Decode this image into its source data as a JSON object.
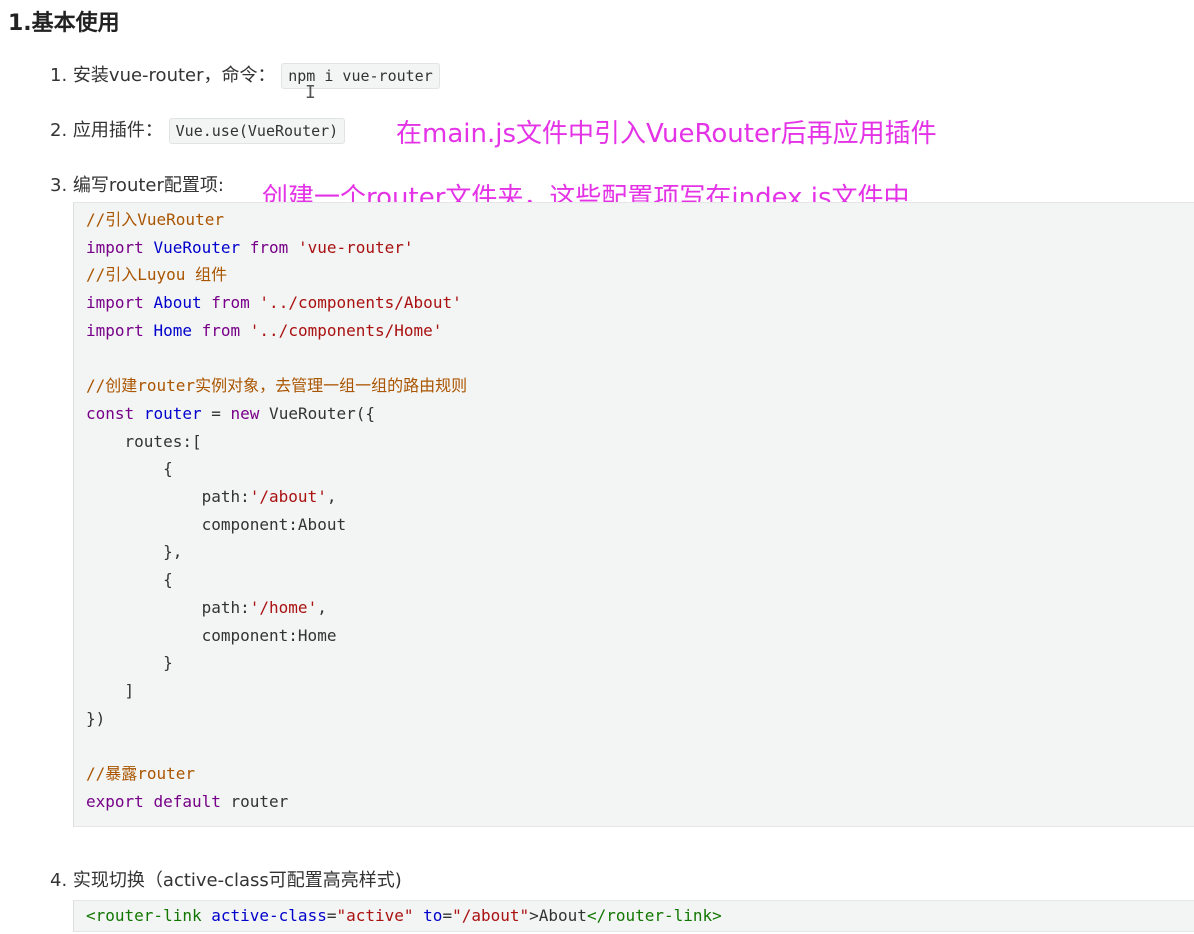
{
  "heading": "1.基本使用",
  "items": [
    {
      "number": "1.",
      "text": "安装vue-router，命令：",
      "code": "npm i vue-router"
    },
    {
      "number": "2.",
      "text": "应用插件：",
      "code": "Vue.use(VueRouter)"
    },
    {
      "number": "3.",
      "text": "编写router配置项:"
    },
    {
      "number": "4.",
      "text": "实现切换（active-class可配置高亮样式)"
    }
  ],
  "annotations": {
    "plugin_note": "在main.js文件中引入VueRouter后再应用插件",
    "config_note": "创建一个router文件夹，这些配置项写在index.js文件中"
  },
  "code_block": {
    "lines": [
      [
        {
          "t": "//引入VueRouter",
          "c": "comment"
        }
      ],
      [
        {
          "t": "import",
          "c": "kw"
        },
        {
          "t": " ",
          "c": "def"
        },
        {
          "t": "VueRouter",
          "c": "var"
        },
        {
          "t": " ",
          "c": "def"
        },
        {
          "t": "from",
          "c": "kw"
        },
        {
          "t": " ",
          "c": "def"
        },
        {
          "t": "'vue-router'",
          "c": "str"
        }
      ],
      [
        {
          "t": "//引入Luyou 组件",
          "c": "comment"
        }
      ],
      [
        {
          "t": "import",
          "c": "kw"
        },
        {
          "t": " ",
          "c": "def"
        },
        {
          "t": "About",
          "c": "var"
        },
        {
          "t": " ",
          "c": "def"
        },
        {
          "t": "from",
          "c": "kw"
        },
        {
          "t": " ",
          "c": "def"
        },
        {
          "t": "'../components/About'",
          "c": "str"
        }
      ],
      [
        {
          "t": "import",
          "c": "kw"
        },
        {
          "t": " ",
          "c": "def"
        },
        {
          "t": "Home",
          "c": "var"
        },
        {
          "t": " ",
          "c": "def"
        },
        {
          "t": "from",
          "c": "kw"
        },
        {
          "t": " ",
          "c": "def"
        },
        {
          "t": "'../components/Home'",
          "c": "str"
        }
      ],
      [],
      [
        {
          "t": "//创建router实例对象，去管理一组一组的路由规则",
          "c": "comment"
        }
      ],
      [
        {
          "t": "const",
          "c": "kw"
        },
        {
          "t": " ",
          "c": "def"
        },
        {
          "t": "router",
          "c": "var"
        },
        {
          "t": " = ",
          "c": "def"
        },
        {
          "t": "new",
          "c": "kw"
        },
        {
          "t": " VueRouter({",
          "c": "def"
        }
      ],
      [
        {
          "t": "    routes:[",
          "c": "def"
        }
      ],
      [
        {
          "t": "        {",
          "c": "def"
        }
      ],
      [
        {
          "t": "            path:",
          "c": "def"
        },
        {
          "t": "'/about'",
          "c": "str"
        },
        {
          "t": ",",
          "c": "def"
        }
      ],
      [
        {
          "t": "            component:About",
          "c": "def"
        }
      ],
      [
        {
          "t": "        },",
          "c": "def"
        }
      ],
      [
        {
          "t": "        {",
          "c": "def"
        }
      ],
      [
        {
          "t": "            path:",
          "c": "def"
        },
        {
          "t": "'/home'",
          "c": "str"
        },
        {
          "t": ",",
          "c": "def"
        }
      ],
      [
        {
          "t": "            component:Home",
          "c": "def"
        }
      ],
      [
        {
          "t": "        }",
          "c": "def"
        }
      ],
      [
        {
          "t": "    ]",
          "c": "def"
        }
      ],
      [
        {
          "t": "})",
          "c": "def"
        }
      ],
      [],
      [
        {
          "t": "//暴露router",
          "c": "comment"
        }
      ],
      [
        {
          "t": "export",
          "c": "kw"
        },
        {
          "t": " ",
          "c": "def"
        },
        {
          "t": "default",
          "c": "kw"
        },
        {
          "t": " router",
          "c": "def"
        }
      ]
    ]
  },
  "code_block_2": {
    "lines": [
      [
        {
          "t": "<router-link",
          "c": "tag"
        },
        {
          "t": " ",
          "c": "def"
        },
        {
          "t": "active-class",
          "c": "attr"
        },
        {
          "t": "=",
          "c": "def"
        },
        {
          "t": "\"active\"",
          "c": "str"
        },
        {
          "t": " ",
          "c": "def"
        },
        {
          "t": "to",
          "c": "attr"
        },
        {
          "t": "=",
          "c": "def"
        },
        {
          "t": "\"/about\"",
          "c": "str"
        },
        {
          "t": ">About",
          "c": "def"
        },
        {
          "t": "</router-link>",
          "c": "tag"
        }
      ]
    ]
  },
  "colors": {
    "annotation": "#e433e6",
    "code_background": "#f3f4f4"
  }
}
